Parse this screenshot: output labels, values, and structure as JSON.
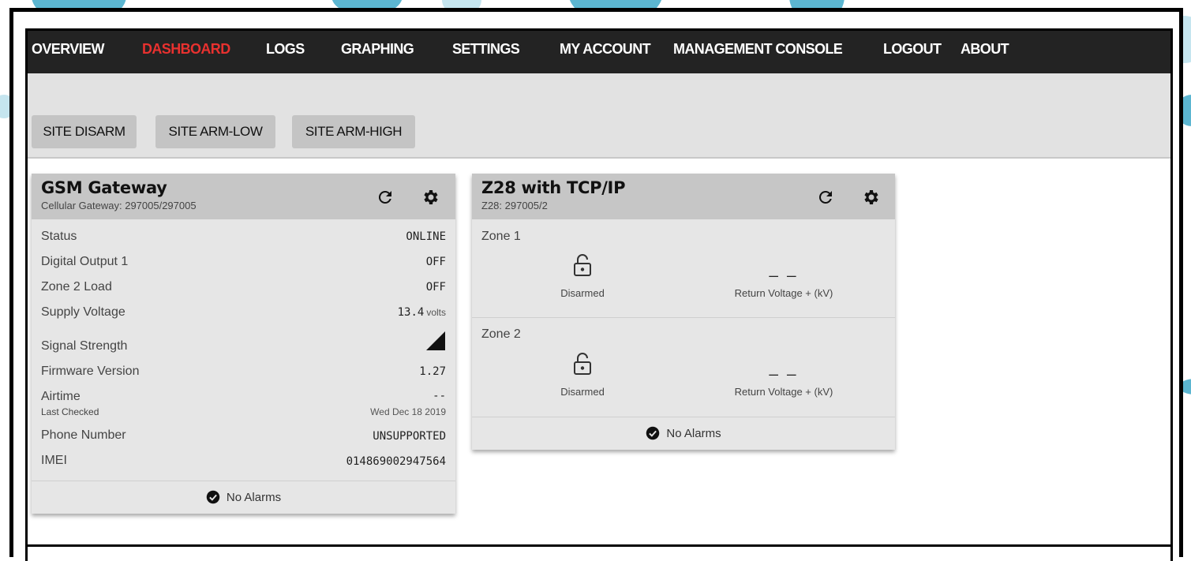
{
  "nav": {
    "items": [
      {
        "label": "OVERVIEW",
        "active": false
      },
      {
        "label": "DASHBOARD",
        "active": true
      },
      {
        "label": "LOGS",
        "active": false
      },
      {
        "label": "GRAPHING",
        "active": false
      },
      {
        "label": "SETTINGS",
        "active": false
      },
      {
        "label": "MY ACCOUNT",
        "active": false
      },
      {
        "label": "MANAGEMENT CONSOLE",
        "active": false
      },
      {
        "label": "LOGOUT",
        "active": false
      },
      {
        "label": "ABOUT",
        "active": false
      }
    ],
    "active_color": "#e8312f"
  },
  "arm_buttons": [
    "SITE DISARM",
    "SITE ARM-LOW",
    "SITE ARM-HIGH"
  ],
  "gateway": {
    "title": "GSM Gateway",
    "subtitle": "Cellular Gateway: 297005/297005",
    "refresh_icon": "refresh-icon",
    "settings_icon": "gear-icon",
    "rows": [
      {
        "label": "Status",
        "value": "ONLINE",
        "unit": ""
      },
      {
        "label": "Digital Output 1",
        "value": "OFF",
        "unit": ""
      },
      {
        "label": "Zone 2 Load",
        "value": "OFF",
        "unit": ""
      },
      {
        "label": "Supply Voltage",
        "value": "13.4",
        "unit": "volts"
      },
      {
        "label": "Signal Strength",
        "value": "",
        "unit": "",
        "icon": "signal-strength-icon"
      },
      {
        "label": "Firmware Version",
        "value": "1.27",
        "unit": ""
      },
      {
        "label": "Airtime",
        "value": "--",
        "unit": ""
      },
      {
        "label": "Phone Number",
        "value": "UNSUPPORTED",
        "unit": ""
      },
      {
        "label": "IMEI",
        "value": "014869002947564",
        "unit": ""
      }
    ],
    "airtime_checked_label": "Last Checked",
    "airtime_checked_value": "Wed Dec 18 2019",
    "footer": "No Alarms",
    "footer_icon": "check-circle-icon"
  },
  "z28": {
    "title": "Z28 with TCP/IP",
    "subtitle": "Z28: 297005/2",
    "refresh_icon": "refresh-icon",
    "settings_icon": "gear-icon",
    "zones": [
      {
        "label": "Zone 1",
        "state": "Disarmed",
        "state_icon": "unlocked-padlock-icon",
        "voltage": "_ _",
        "voltage_label": "Return Voltage + (kV)"
      },
      {
        "label": "Zone 2",
        "state": "Disarmed",
        "state_icon": "unlocked-padlock-icon",
        "voltage": "_ _",
        "voltage_label": "Return Voltage + (kV)"
      }
    ],
    "footer": "No Alarms",
    "footer_icon": "check-circle-icon"
  }
}
